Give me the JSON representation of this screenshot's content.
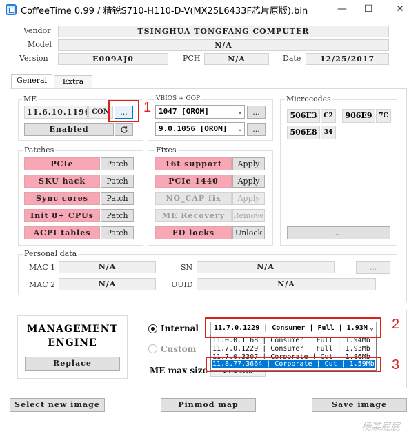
{
  "window": {
    "title": "CoffeeTime 0.99  /  精锐S710-H110-D-V(MX25L6433F芯片原版).bin",
    "minimize": "—",
    "maximize": "☐",
    "close": "✕"
  },
  "header": {
    "vendor_label": "Vendor",
    "vendor_value": "TSINGHUA TONGFANG COMPUTER",
    "model_label": "Model",
    "model_value": "N/A",
    "version_label": "Version",
    "version_value": "E009AJ0",
    "pch_label": "PCH",
    "pch_value": "N/A",
    "date_label": "Date",
    "date_value": "12/25/2017"
  },
  "tabs": [
    {
      "label": "General"
    },
    {
      "label": "Extra"
    }
  ],
  "me": {
    "title": "ME",
    "version": "11.6.10.1196",
    "type": "CON",
    "browse": "...",
    "status_button": "Enabled",
    "refresh_icon": "refresh-icon"
  },
  "vbios": {
    "title": "VBIOS + GOP",
    "vbios_value": "1047 [OROM]",
    "gop_value": "9.0.1056 [OROM]",
    "browse": "..."
  },
  "microcodes": {
    "title": "Microcodes",
    "items": [
      {
        "id": "506E3",
        "sub": "C2"
      },
      {
        "id": "906E9",
        "sub": "7C"
      },
      {
        "id": "506E8",
        "sub": "34"
      }
    ],
    "more": "..."
  },
  "patches": {
    "title": "Patches",
    "items": [
      {
        "name": "PCIe",
        "action": "Patch"
      },
      {
        "name": "SKU hack",
        "action": "Patch"
      },
      {
        "name": "Sync cores",
        "action": "Patch"
      },
      {
        "name": "Init 8+ CPUs",
        "action": "Patch"
      },
      {
        "name": "ACPI tables",
        "action": "Patch"
      }
    ]
  },
  "fixes": {
    "title": "Fixes",
    "items": [
      {
        "name": "16t support",
        "action": "Apply"
      },
      {
        "name": "PCIe 1440",
        "action": "Apply"
      },
      {
        "name": "NO_CAP fix",
        "action": "Apply"
      },
      {
        "name": "ME Recovery",
        "action": "Remove"
      },
      {
        "name": "FD locks",
        "action": "Unlock"
      }
    ]
  },
  "personal": {
    "title": "Personal data",
    "mac1_label": "MAC 1",
    "mac1_value": "N/A",
    "mac2_label": "MAC 2",
    "mac2_value": "N/A",
    "sn_label": "SN",
    "sn_value": "N/A",
    "uuid_label": "UUID",
    "uuid_value": "N/A",
    "more": "..."
  },
  "me_engine": {
    "title_line1": "MANAGEMENT",
    "title_line2": "ENGINE",
    "replace": "Replace",
    "internal_label": "Internal",
    "custom_label": "Custom",
    "max_size_label": "ME max size",
    "max_size_value": "1.99Mb",
    "selected": "11.7.0.1229 | Consumer | Full | 1.93Mb",
    "options": [
      "11.0.0.1168 | Consumer | Full | 1.94Mb",
      "11.7.0.1229 | Consumer | Full | 1.93Mb",
      "11.7.0.3307 | Corporate | Cut | 1.86Mb",
      "11.8.77.3664 | Corporate | Cut | 1.59Mb"
    ]
  },
  "annotations": {
    "n1": "1",
    "n2": "2",
    "n3": "3",
    "color": "#e0201a"
  },
  "footer": {
    "select_image": "Select new image",
    "pinmod_map": "Pinmod map",
    "save_image": "Save image",
    "watermark": "杨某屁屁"
  }
}
